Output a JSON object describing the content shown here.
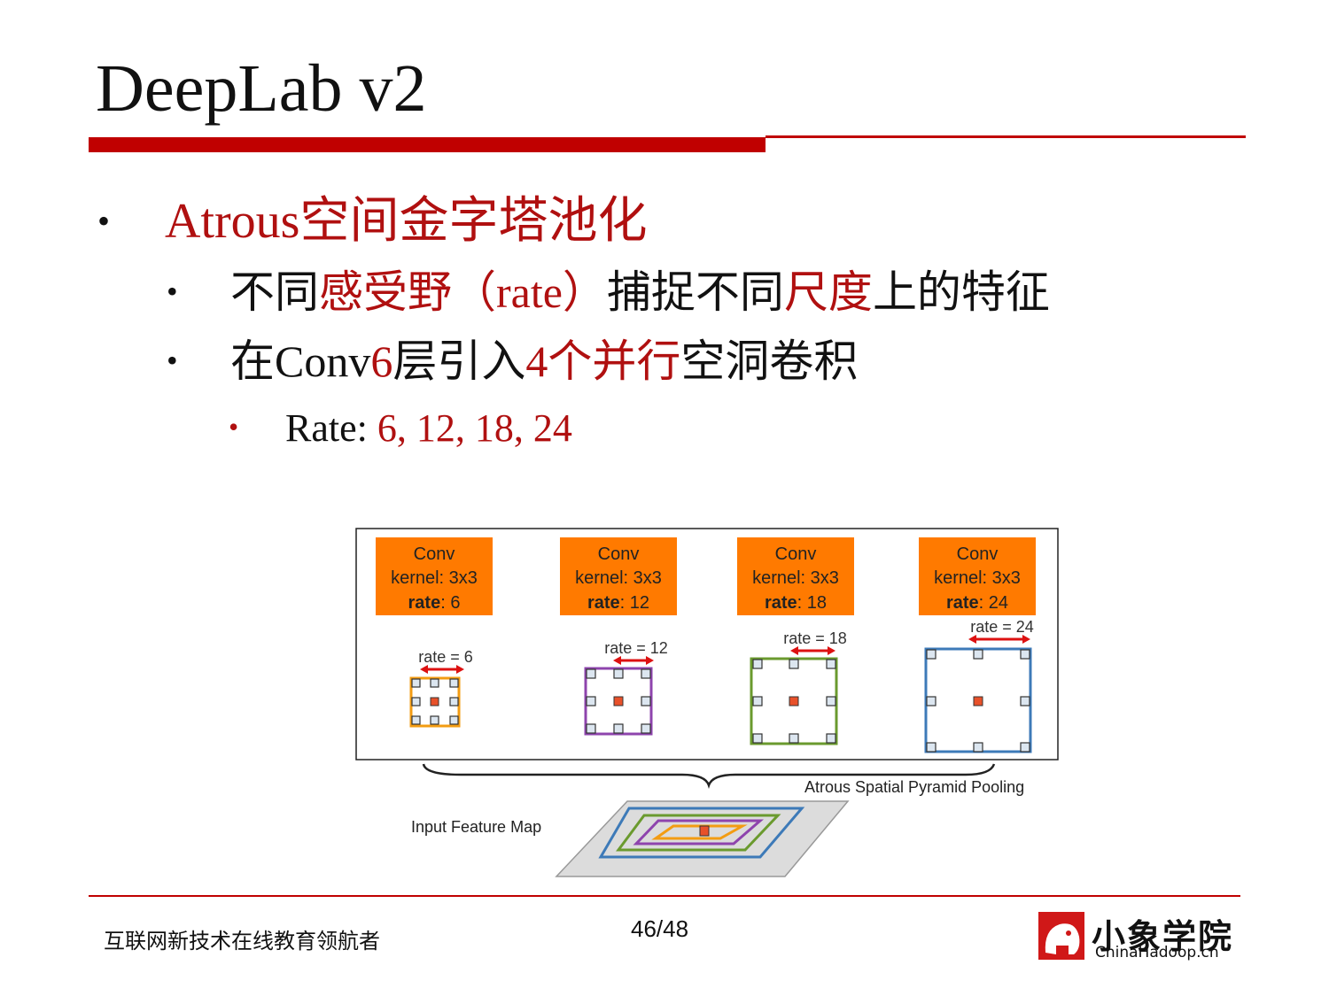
{
  "slide": {
    "title": "DeepLab v2",
    "bullets": {
      "l1": {
        "bullet": "•",
        "text": "Atrous空间金字塔池化"
      },
      "l2a": {
        "bullet": "•",
        "p1": "不同",
        "p2": "感受野（rate）",
        "p3": "捕捉不同",
        "p4": "尺度",
        "p5": "上的特征"
      },
      "l2b": {
        "bullet": "•",
        "p1": "在Conv",
        "p2": "6",
        "p3": "层引入",
        "p4": "4个并行",
        "p5": "空洞卷积"
      },
      "l3": {
        "bullet": "•",
        "p1": "Rate: ",
        "p2": "6, 12, 18, 24"
      }
    }
  },
  "diagram": {
    "branches": [
      {
        "line1": "Conv",
        "line2": "kernel: 3x3",
        "rate_label": "rate",
        "rate_value": ": 6",
        "arrow_label": "rate = 6",
        "color": "#f39c12"
      },
      {
        "line1": "Conv",
        "line2": "kernel: 3x3",
        "rate_label": "rate",
        "rate_value": ": 12",
        "arrow_label": "rate = 12",
        "color": "#8e44ad"
      },
      {
        "line1": "Conv",
        "line2": "kernel: 3x3",
        "rate_label": "rate",
        "rate_value": ": 18",
        "arrow_label": "rate = 18",
        "color": "#6a9a2e"
      },
      {
        "line1": "Conv",
        "line2": "kernel: 3x3",
        "rate_label": "rate",
        "rate_value": ": 24",
        "arrow_label": "rate = 24",
        "color": "#3d7ab8"
      }
    ],
    "aspp_label": "Atrous Spatial Pyramid Pooling",
    "input_label": "Input Feature Map",
    "box_fill": "#ff7a00",
    "center_color": "#e8512a"
  },
  "footer": {
    "tagline": "互联网新技术在线教育领航者",
    "page": "46/48",
    "logo_cn": "小象学院",
    "logo_en": "ChinaHadoop.cn"
  },
  "colors": {
    "accent": "#c00000",
    "text_red": "#b01010"
  }
}
